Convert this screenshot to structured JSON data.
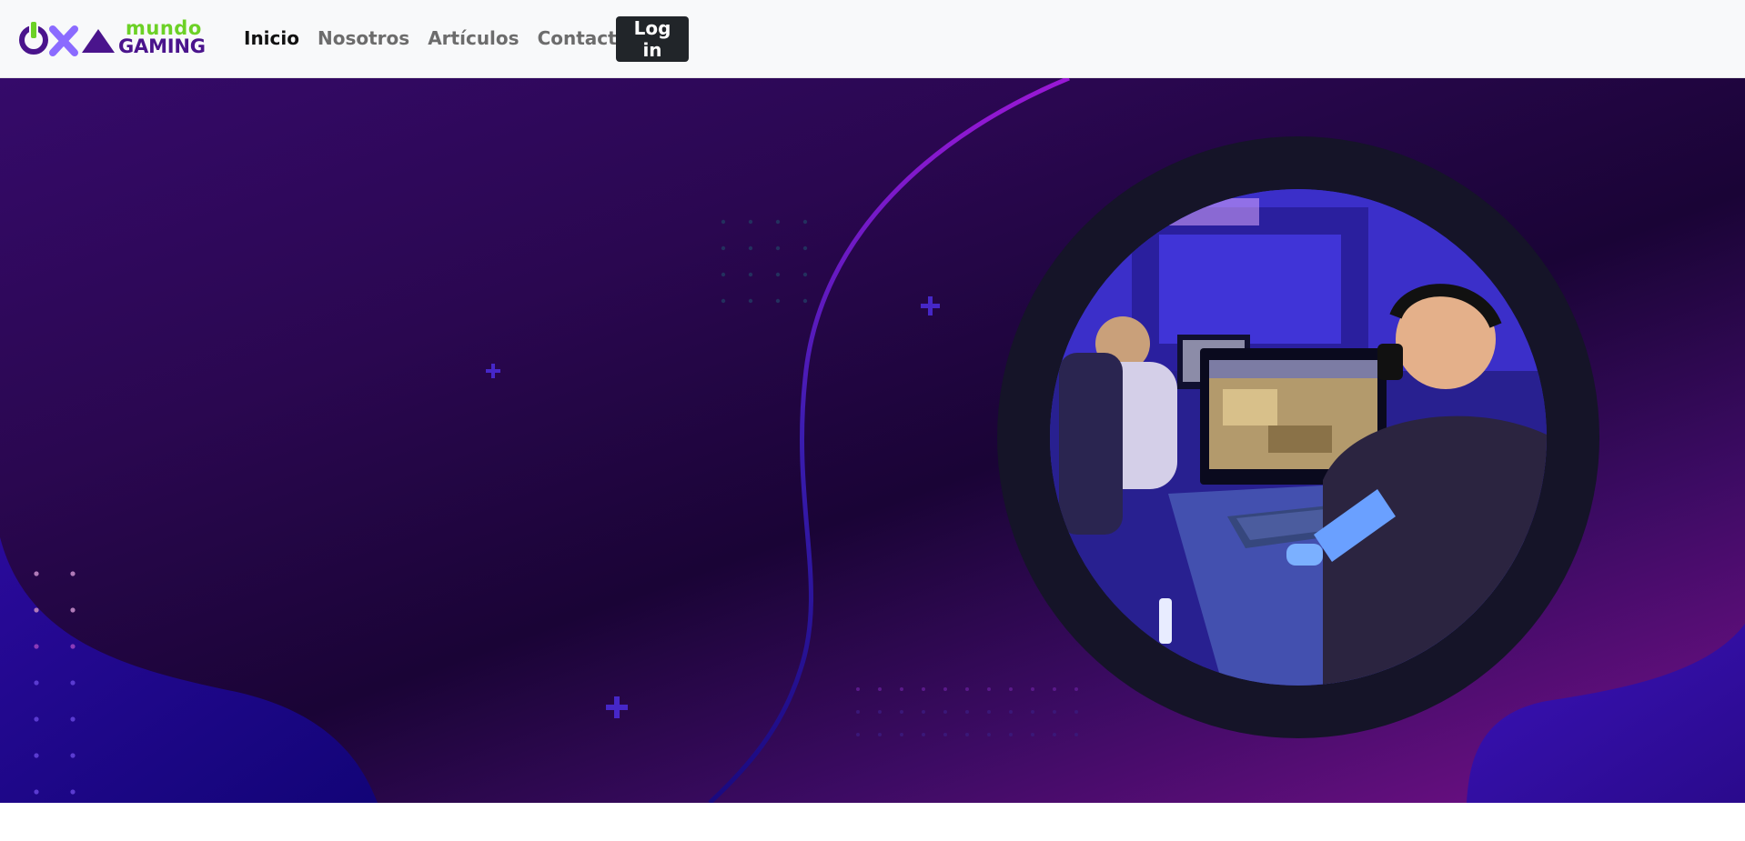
{
  "logo": {
    "name_top": "mundo",
    "name_bottom": "GAMING",
    "brand_green": "#6cd126",
    "brand_purple": "#4a148c"
  },
  "nav": {
    "items": [
      {
        "label": "Inicio",
        "active": true
      },
      {
        "label": "Nosotros",
        "active": false
      },
      {
        "label": "Artículos",
        "active": false
      },
      {
        "label": "Contacto",
        "active": false
      }
    ],
    "login_label": "Log in"
  },
  "hero": {
    "image_icon": "esports-gamers-photo",
    "colors": {
      "deep_purple": "#1a0436",
      "magenta": "#76108a",
      "blue": "#1d0a8c"
    }
  }
}
